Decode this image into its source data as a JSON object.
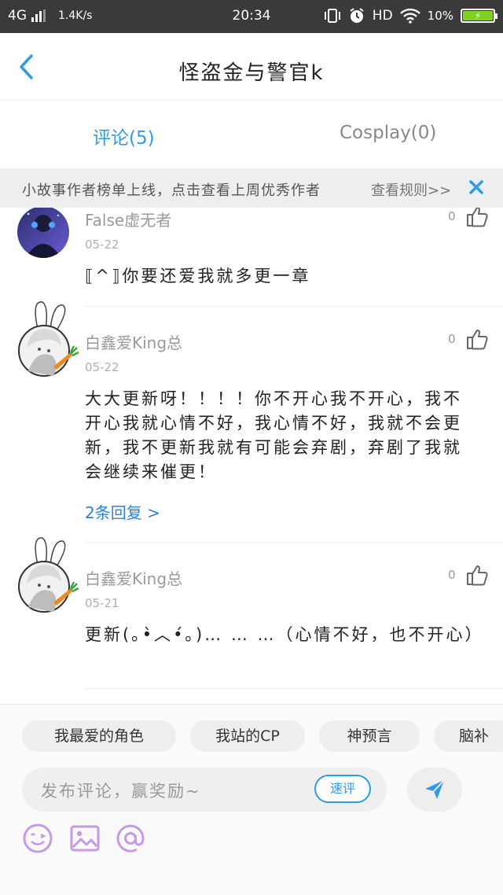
{
  "status_bar": {
    "network": "4G",
    "speed": "1.4K/s",
    "time": "20:34",
    "hd": "HD",
    "battery": "10%",
    "icons": [
      "signal-icon",
      "vibrate-icon",
      "alarm-icon",
      "wifi-icon",
      "battery-icon"
    ]
  },
  "header": {
    "title": "怪盗金与警官k",
    "back_icon": "back-arrow-icon"
  },
  "tabs": [
    {
      "label": "评论(5)",
      "active": true
    },
    {
      "label": "Cosplay(0)",
      "active": false
    }
  ],
  "notice": {
    "text": "小故事作者榜单上线，点击查看上周优秀作者",
    "rules": "查看规则>>",
    "close_icon": "close-icon"
  },
  "comments": [
    {
      "user": "False虚无者",
      "date": "05-22",
      "likes": "0",
      "body": "⟦^⟧你要还爱我就多更一章",
      "replies": ""
    },
    {
      "user": "白鑫爱King总",
      "date": "05-22",
      "likes": "0",
      "body": "大大更新呀！！！！你不开心我不开心，我不开心我就心情不好，我心情不好，我就不会更新，我不更新我就有可能会弃剧，弃剧了我就会继续来催更！",
      "replies": "2条回复 >"
    },
    {
      "user": "白鑫爱King总",
      "date": "05-21",
      "likes": "0",
      "body": "更新(｡•̀︿•́｡)… … …（心情不好，也不开心）",
      "replies": ""
    }
  ],
  "bottom": {
    "chips": [
      "我最爱的角色",
      "我站的CP",
      "神预言",
      "脑补"
    ],
    "input_placeholder": "发布评论，赢奖励~",
    "quick_review": "速评",
    "tools": [
      "emoji-icon",
      "image-icon",
      "at-icon"
    ]
  },
  "colors": {
    "accent": "#2f9be7",
    "link": "#2f7fd8",
    "status_bar": "#3a3a3a",
    "notice_bg": "#eeeeee",
    "tool_icons": "#c59ae6"
  }
}
